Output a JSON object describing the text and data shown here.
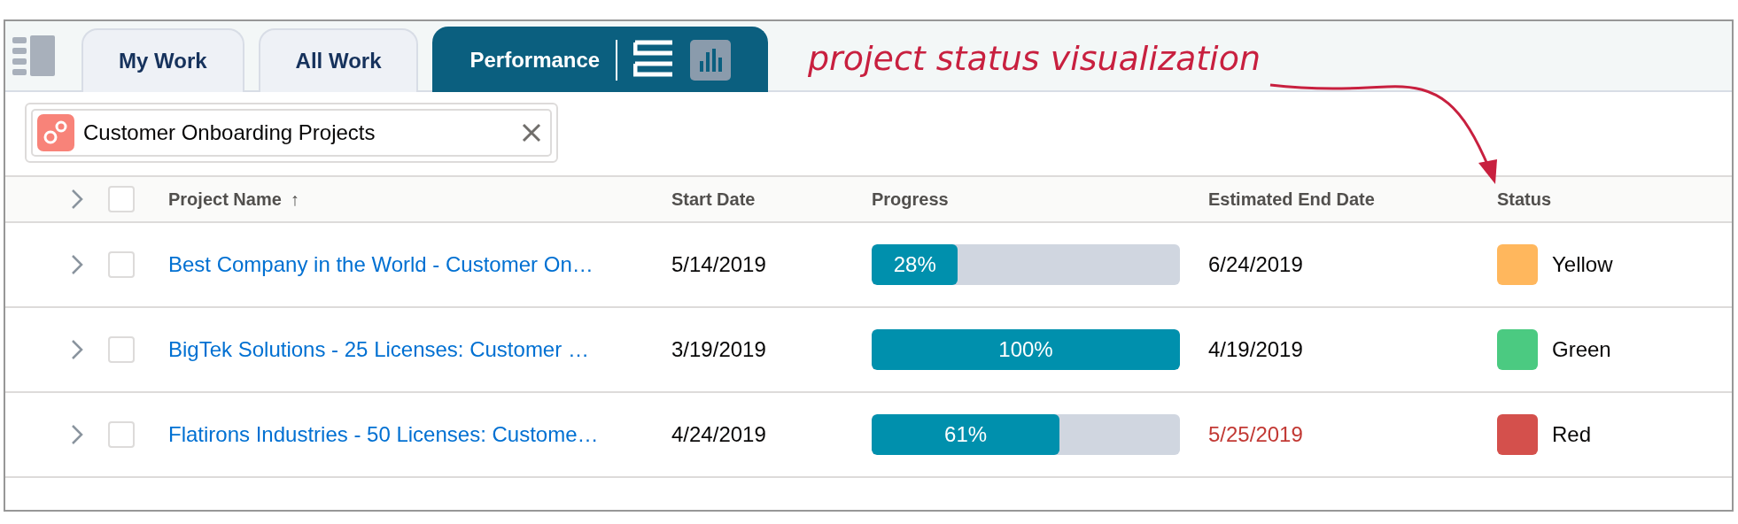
{
  "tabs": [
    {
      "label": "My Work",
      "selected": false
    },
    {
      "label": "All Work",
      "selected": false
    },
    {
      "label": "Performance",
      "selected": true
    }
  ],
  "annotation": {
    "text": "project status visualization"
  },
  "filter": {
    "label": "Customer Onboarding Projects"
  },
  "table": {
    "columns": [
      {
        "label": "Project Name",
        "sort_indicator": "↑"
      },
      {
        "label": "Start Date"
      },
      {
        "label": "Progress"
      },
      {
        "label": "Estimated End Date"
      },
      {
        "label": "Status"
      }
    ],
    "header_checked": false,
    "rows": [
      {
        "expanded": false,
        "checked": false,
        "name": "Best Company in the World - Customer On…",
        "start": "5/14/2019",
        "progress_label": "28%",
        "level": 0.28,
        "end": "6/24/2019",
        "overdue": false,
        "status": "Yellow",
        "color": "#ffb75d"
      },
      {
        "expanded": false,
        "checked": false,
        "name": "BigTek Solutions - 25 Licenses: Customer …",
        "start": "3/19/2019",
        "progress_label": "100%",
        "level": 1.0,
        "end": "4/19/2019",
        "overdue": false,
        "status": "Green",
        "color": "#4bca81"
      },
      {
        "expanded": false,
        "checked": false,
        "name": "Flatirons Industries - 50 Licenses: Custome…",
        "start": "4/24/2019",
        "progress_label": "61%",
        "level": 0.61,
        "end": "5/25/2019",
        "overdue": true,
        "status": "Red",
        "color": "#d4504c"
      }
    ]
  }
}
